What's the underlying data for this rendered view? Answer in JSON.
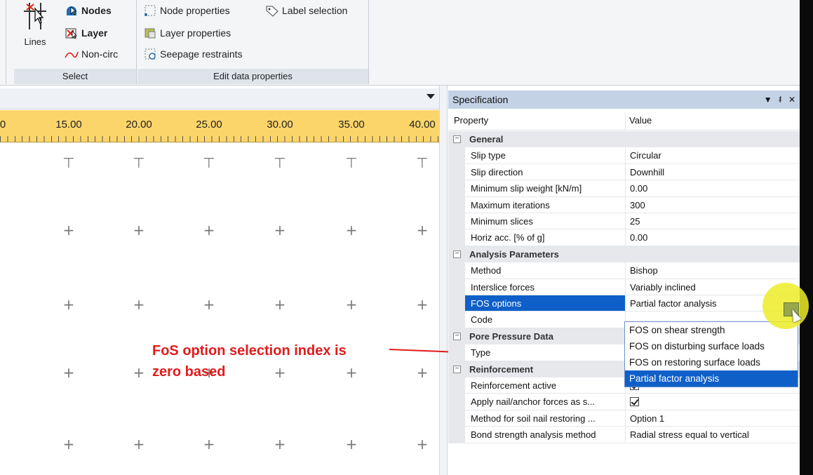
{
  "ribbon": {
    "select_group": {
      "label": "Select",
      "lines_label": "Lines",
      "nodes_label": "Nodes",
      "layer_label": "Layer",
      "noncirc_label": "Non-circ"
    },
    "edit_group": {
      "label": "Edit data properties",
      "node_properties": "Node properties",
      "label_selection": "Label selection",
      "layer_properties": "Layer properties",
      "seepage_restraints": "Seepage restraints"
    }
  },
  "ruler": {
    "labels": [
      "0",
      "15.00",
      "20.00",
      "25.00",
      "30.00",
      "35.00",
      "40.00"
    ]
  },
  "annotation": {
    "line1": "FoS option selection index is",
    "line2": "zero based",
    "color": "#e11b1b"
  },
  "spec": {
    "title": "Specification",
    "col_property": "Property",
    "col_value": "Value",
    "general": "General",
    "analysis": "Analysis Parameters",
    "pore": "Pore Pressure Data",
    "reinforcement": "Reinforcement",
    "rows": {
      "slip_type": {
        "p": "Slip type",
        "v": "Circular"
      },
      "slip_direction": {
        "p": "Slip direction",
        "v": "Downhill"
      },
      "min_slip_weight": {
        "p": "Minimum slip weight [kN/m]",
        "v": "0.00"
      },
      "max_iterations": {
        "p": "Maximum iterations",
        "v": "300"
      },
      "min_slices": {
        "p": "Minimum slices",
        "v": "25"
      },
      "horiz_acc": {
        "p": "Horiz acc. [% of g]",
        "v": "0.00"
      },
      "method": {
        "p": "Method",
        "v": "Bishop"
      },
      "interslice": {
        "p": "Interslice forces",
        "v": "Variably inclined"
      },
      "fos_options": {
        "p": "FOS options",
        "v": "Partial factor analysis"
      },
      "code": {
        "p": "Code",
        "v": ""
      },
      "type": {
        "p": "Type",
        "v": ""
      },
      "reinf_active": {
        "p": "Reinforcement active"
      },
      "apply_nail": {
        "p": "Apply nail/anchor forces as s..."
      },
      "soil_nail": {
        "p": "Method for soil nail restoring ...",
        "v": "Option 1"
      },
      "bond_strength": {
        "p": "Bond strength analysis method",
        "v": "Radial stress equal to vertical"
      }
    },
    "dropdown": [
      "FOS on shear strength",
      "FOS on disturbing surface loads",
      "FOS on restoring surface loads",
      "Partial factor analysis"
    ]
  }
}
